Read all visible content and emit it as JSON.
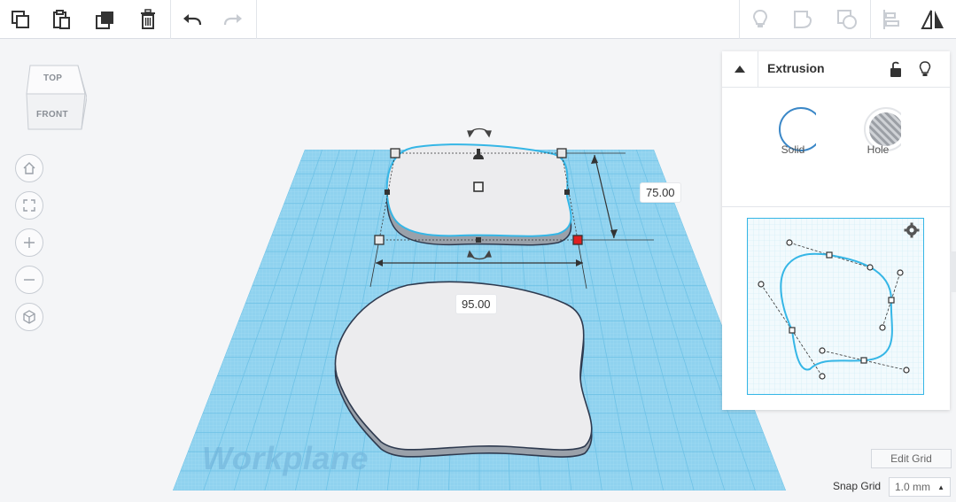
{
  "toolbar": {
    "left_tools": [
      "copy-icon",
      "paste-icon",
      "duplicate-icon",
      "delete-icon"
    ],
    "history_tools": [
      "undo-icon",
      "redo-icon"
    ],
    "right_tools": [
      "show-all-icon",
      "group-icon",
      "ungroup-icon",
      "align-icon",
      "mirror-icon"
    ]
  },
  "viewcube": {
    "top": "TOP",
    "front": "FRONT"
  },
  "nav": [
    "home-view-icon",
    "fit-view-icon",
    "zoom-in-icon",
    "zoom-out-icon",
    "perspective-icon"
  ],
  "dimensions": {
    "width": "95.00",
    "depth": "75.00"
  },
  "workplane_label": "Workplane",
  "inspector": {
    "title": "Extrusion",
    "solid_label": "Solid",
    "hole_label": "Hole",
    "selected": "Solid"
  },
  "bottom": {
    "edit_grid": "Edit Grid",
    "snap_label": "Snap Grid",
    "snap_value": "1.0 mm"
  },
  "colors": {
    "accent": "#35b6e6",
    "workplane": "#8fd2ef",
    "handle_active": "#e02020"
  }
}
